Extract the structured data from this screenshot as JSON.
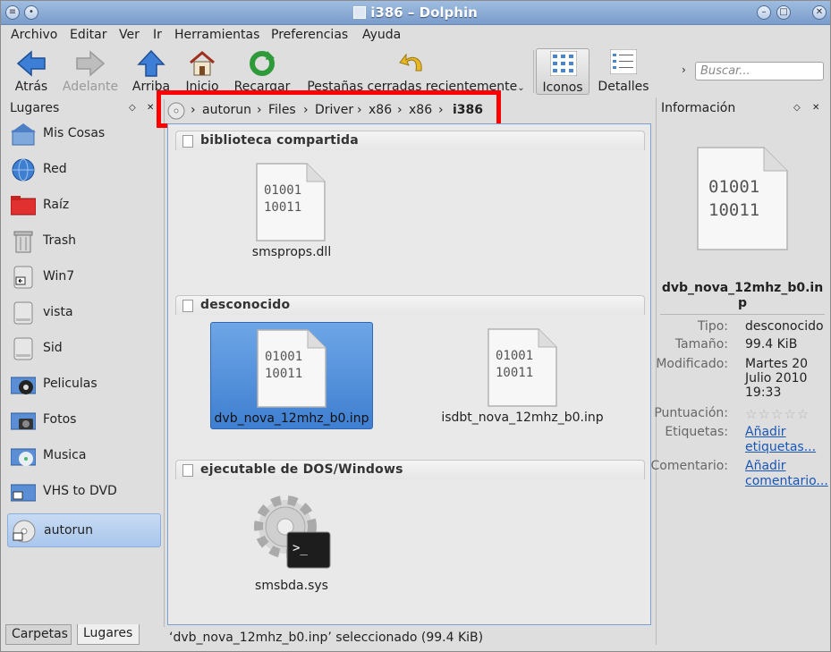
{
  "window": {
    "title": "i386 – Dolphin"
  },
  "menu": [
    "Archivo",
    "Editar",
    "Ver",
    "Ir",
    "Herramientas",
    "Preferencias",
    "Ayuda"
  ],
  "toolbar": {
    "back": "Atrás",
    "forward": "Adelante",
    "up": "Arriba",
    "home": "Inicio",
    "reload": "Recargar",
    "closed_tabs": "Pestañas cerradas recientemente",
    "icons_view": "Iconos",
    "details_view": "Detalles",
    "search_placeholder": "Buscar..."
  },
  "places": {
    "title": "Lugares",
    "items": [
      "Mis Cosas",
      "Red",
      "Raíz",
      "Trash",
      "Win7",
      "vista",
      "Sid",
      "Peliculas",
      "Fotos",
      "Musica",
      "VHS to DVD",
      "autorun"
    ],
    "selected": "autorun",
    "tabs": [
      "Carpetas",
      "Lugares"
    ],
    "active_tab": "Lugares"
  },
  "breadcrumb": [
    "autorun",
    "Files",
    "Driver",
    "x86",
    "x86",
    "i386"
  ],
  "groups": [
    {
      "title": "biblioteca compartida",
      "files": [
        "smsprops.dll"
      ]
    },
    {
      "title": "desconocido",
      "files": [
        "dvb_nova_12mhz_b0.inp",
        "isdbt_nova_12mhz_b0.inp"
      ]
    },
    {
      "title": "ejecutable de DOS/Windows",
      "files": [
        "smsbda.sys"
      ]
    }
  ],
  "selected_file": "dvb_nova_12mhz_b0.inp",
  "info": {
    "title": "Información",
    "name": "dvb_nova_12mhz_b0.inp",
    "type_label": "Tipo:",
    "type": "desconocido",
    "size_label": "Tamaño:",
    "size": "99.4 KiB",
    "modified_label": "Modificado:",
    "modified": [
      "Martes 20",
      "Julio 2010",
      "19:33"
    ],
    "rating_label": "Puntuación:",
    "rating": 0,
    "tags_label": "Etiquetas:",
    "tags_link": [
      "Añadir",
      "etiquetas..."
    ],
    "comment_label": "Comentario:",
    "comment_link": [
      "Añadir",
      "comentario..."
    ]
  },
  "status": "‘dvb_nova_12mhz_b0.inp’ seleccionado (99.4 KiB)",
  "colors": {
    "selection": "#4a8ad8",
    "highlight_box": "#ff0000",
    "link": "#1a56b4"
  }
}
